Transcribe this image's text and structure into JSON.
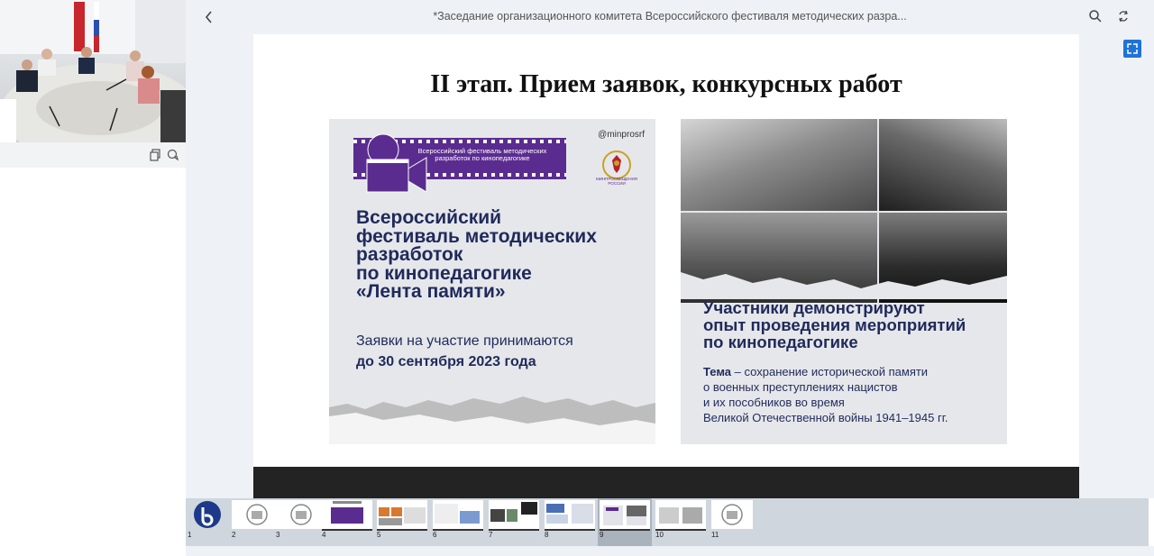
{
  "header": {
    "title": "*Заседание организационного комитета Всероссийского фестиваля методических разра..."
  },
  "slide": {
    "title": "II этап. Прием заявок, конкурсных работ",
    "poster": {
      "film_text": "Всероссийский фестиваль методических разработок по кинопедагогике",
      "handle": "@minprosrf",
      "emblem_caption": "МИНПРОСВЕЩЕНИЯ РОССИИ",
      "heading_lines": [
        "Всероссийский",
        "фестиваль методических",
        "разработок",
        "по кинопедагогике",
        "«Лента памяти»"
      ],
      "sub1": "Заявки на участие принимаются",
      "sub2": "до 30 сентября 2023 года"
    },
    "collage": {
      "heading_lines": [
        "Участники демонстрируют",
        "опыт проведения мероприятий",
        "по кинопедагогике"
      ],
      "theme_bold": "Тема",
      "theme_lines": [
        "– сохранение исторической памяти",
        "о военных преступлениях нацистов",
        "и их пособников во время",
        "Великой Отечественной войны 1941–1945 гг."
      ]
    }
  },
  "thumbnails": [
    {
      "num": "1"
    },
    {
      "num": "2"
    },
    {
      "num": "3"
    },
    {
      "num": "4"
    },
    {
      "num": "5"
    },
    {
      "num": "6"
    },
    {
      "num": "7"
    },
    {
      "num": "8"
    },
    {
      "num": "9"
    },
    {
      "num": "10"
    },
    {
      "num": "11"
    }
  ],
  "icons": {
    "back": "chevron-left-icon",
    "search": "search-icon",
    "sync": "sync-icon",
    "expand": "fullscreen-icon",
    "copy": "copy-icon",
    "chat": "chat-icon",
    "app_logo": "bigbluebutton-logo"
  },
  "colors": {
    "accent": "#1e73d8",
    "poster_purple": "#5b2c8f",
    "poster_navy": "#1f2a5c"
  }
}
